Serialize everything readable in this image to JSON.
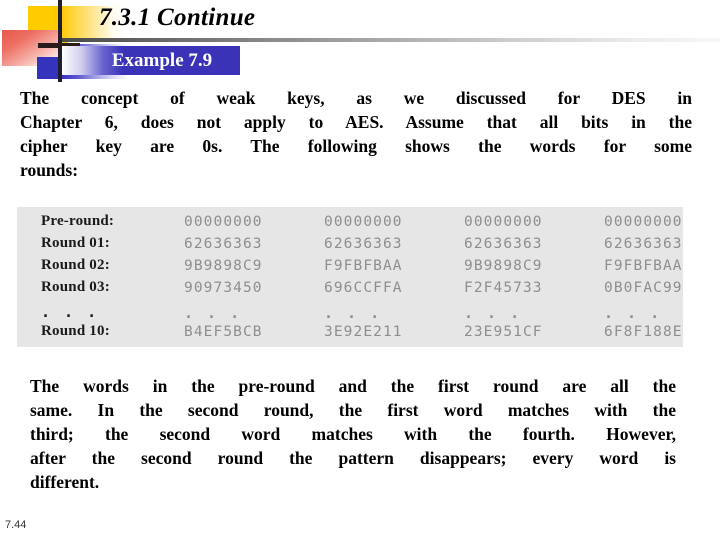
{
  "slide": {
    "title": "7.3.1  Continue",
    "banner_label": "Example 7.9",
    "page_number": "7.44",
    "accent_blue": "#3A33B8",
    "accent_yellow": "#FFCC00",
    "accent_red": "#E8574C",
    "table_bg": "#E6E6E6",
    "hex_color": "#8E8E8E"
  },
  "paragraph_top": {
    "lines": [
      "The  concept  of  weak  keys,  as  we  discussed  for  DES  in",
      "Chapter 6, does not apply to AES. Assume that all bits in the",
      "cipher key are 0s. The following shows the words for some",
      "rounds:"
    ],
    "full_text": "The concept of weak keys, as we discussed for DES in Chapter 6, does not apply to AES. Assume that all bits in the cipher key are 0s. The following shows the words for some rounds:"
  },
  "paragraph_bottom": {
    "lines": [
      "The words in the pre-round and the first round are all the",
      "same. In the second round, the first word matches with the",
      "third; the second word matches with the fourth. However,",
      "after the second round the pattern disappears; every word is",
      "different."
    ],
    "full_text": "The words in the pre-round and the first round are all the same. In the second round, the first word matches with the third; the second word matches with the fourth. However, after the second round the pattern disappears; every word is different."
  },
  "key_schedule": {
    "rows": [
      {
        "label": "Pre-round:",
        "words": [
          "00000000",
          "00000000",
          "00000000",
          "00000000"
        ]
      },
      {
        "label": "Round 01:",
        "words": [
          "62636363",
          "62636363",
          "62636363",
          "62636363"
        ]
      },
      {
        "label": "Round 02:",
        "words": [
          "9B9898C9",
          "F9FBFBAA",
          "9B9898C9",
          "F9FBFBAA"
        ]
      },
      {
        "label": "Round 03:",
        "words": [
          "90973450",
          "696CCFFA",
          "F2F45733",
          "0B0FAC99"
        ]
      },
      {
        "label": ". . .",
        "words": [
          ". . .",
          ". . .",
          ". . .",
          ". . ."
        ]
      },
      {
        "label": "Round 10:",
        "words": [
          "B4EF5BCB",
          "3E92E211",
          "23E951CF",
          "6F8F188E"
        ]
      }
    ]
  }
}
